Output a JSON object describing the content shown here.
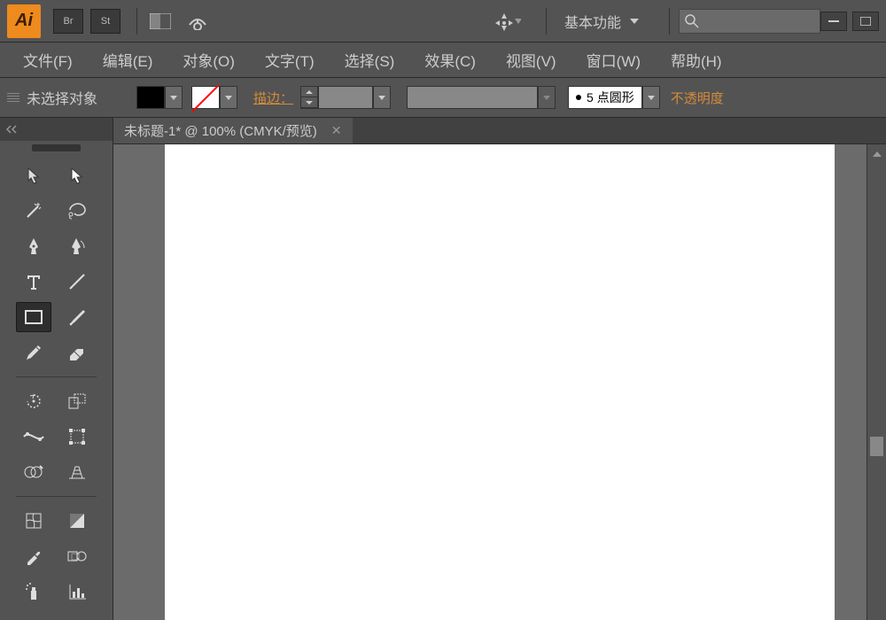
{
  "header": {
    "logo_text": "Ai",
    "bridge_label": "Br",
    "stock_label": "St",
    "workspace_label": "基本功能",
    "search_placeholder": ""
  },
  "menu": {
    "file": "文件(F)",
    "edit": "编辑(E)",
    "object": "对象(O)",
    "type": "文字(T)",
    "select": "选择(S)",
    "effect": "效果(C)",
    "view": "视图(V)",
    "window": "窗口(W)",
    "help": "帮助(H)"
  },
  "options": {
    "no_selection": "未选择对象",
    "stroke_label": "描边：",
    "brush_value": "5 点圆形",
    "opacity_label": "不透明度"
  },
  "document": {
    "tab_title": "未标题-1* @ 100% (CMYK/预览)"
  },
  "tools": [
    {
      "name": "selection-tool",
      "icon": "arrow"
    },
    {
      "name": "direct-selection-tool",
      "icon": "arrow-white"
    },
    {
      "name": "magic-wand-tool",
      "icon": "wand"
    },
    {
      "name": "lasso-tool",
      "icon": "lasso"
    },
    {
      "name": "pen-tool",
      "icon": "pen"
    },
    {
      "name": "curvature-tool",
      "icon": "pen-curve"
    },
    {
      "name": "type-tool",
      "icon": "type"
    },
    {
      "name": "line-tool",
      "icon": "line"
    },
    {
      "name": "rectangle-tool",
      "icon": "rect",
      "selected": true
    },
    {
      "name": "paintbrush-tool",
      "icon": "brush"
    },
    {
      "name": "pencil-tool",
      "icon": "pencil"
    },
    {
      "name": "eraser-tool",
      "icon": "eraser"
    },
    {
      "sep": true
    },
    {
      "name": "rotate-tool",
      "icon": "rotate"
    },
    {
      "name": "scale-tool",
      "icon": "scale"
    },
    {
      "name": "width-tool",
      "icon": "width"
    },
    {
      "name": "free-transform-tool",
      "icon": "transform"
    },
    {
      "name": "shape-builder-tool",
      "icon": "shapebuilder"
    },
    {
      "name": "perspective-tool",
      "icon": "perspective"
    },
    {
      "sep": true
    },
    {
      "name": "mesh-tool",
      "icon": "mesh"
    },
    {
      "name": "gradient-tool",
      "icon": "gradient"
    },
    {
      "name": "eyedropper-tool",
      "icon": "eyedropper"
    },
    {
      "name": "blend-tool",
      "icon": "blend"
    },
    {
      "name": "symbol-sprayer-tool",
      "icon": "spray"
    },
    {
      "name": "graph-tool",
      "icon": "graph"
    }
  ]
}
